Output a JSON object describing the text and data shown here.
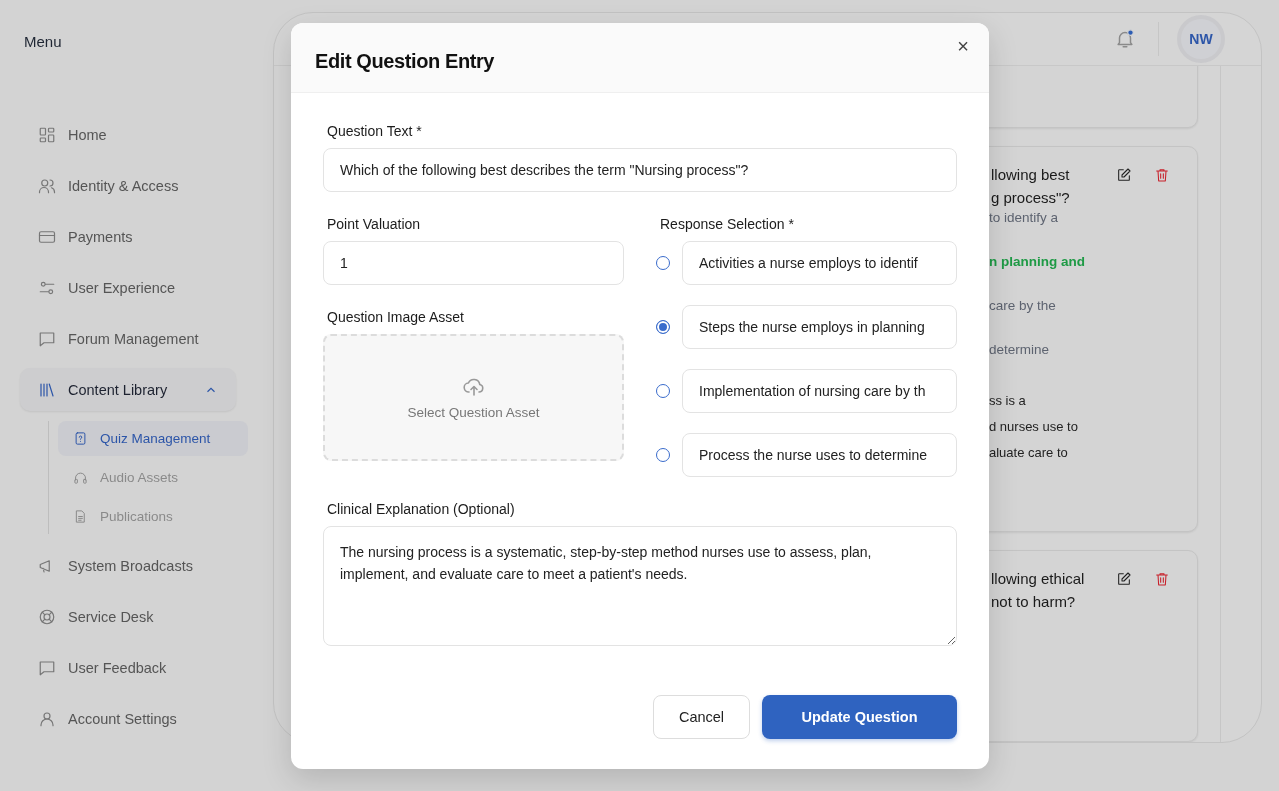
{
  "sidebar": {
    "title": "Menu",
    "items": [
      {
        "label": "Home",
        "selected": false
      },
      {
        "label": "Identity & Access",
        "selected": false
      },
      {
        "label": "Payments",
        "selected": false
      },
      {
        "label": "User Experience",
        "selected": false
      },
      {
        "label": "Forum Management",
        "selected": false
      },
      {
        "label": "Content Library",
        "selected": true,
        "expanded": true,
        "children": [
          {
            "label": "Quiz Management",
            "selected": true
          },
          {
            "label": "Audio Assets",
            "selected": false
          },
          {
            "label": "Publications",
            "selected": false
          }
        ]
      },
      {
        "label": "System Broadcasts",
        "selected": false
      },
      {
        "label": "Service Desk",
        "selected": false
      },
      {
        "label": "User Feedback",
        "selected": false
      },
      {
        "label": "Account Settings",
        "selected": false
      }
    ]
  },
  "header": {
    "notification_unread": true,
    "avatar": "NW"
  },
  "cards": [
    {
      "title_lines": [
        "llowing best",
        "g process\"?"
      ],
      "options": [
        {
          "text": "to identify a",
          "correct": false
        },
        {
          "text": "n planning and",
          "correct": true
        },
        {
          "text": "care by the",
          "correct": false
        },
        {
          "text": "determine",
          "correct": false
        }
      ],
      "explanation_lines": [
        "ss is a",
        "d nurses use to",
        "aluate care to"
      ]
    },
    {
      "title_lines": [
        "llowing ethical",
        "not to harm?"
      ]
    }
  ],
  "dialog": {
    "title": "Edit Question Entry",
    "close": "×",
    "question_label": "Question Text *",
    "question_value": "Which of the following best describes the term \"Nursing process\"?",
    "points_label": "Point Valuation",
    "points_value": "1",
    "image_label": "Question Image Asset",
    "image_prompt": "Select Question Asset",
    "responses_label": "Response Selection *",
    "responses": [
      {
        "text": "Activities a nurse employs to identif",
        "selected": false
      },
      {
        "text": "Steps the nurse employs in planning",
        "selected": true
      },
      {
        "text": "Implementation of nursing care by th",
        "selected": false
      },
      {
        "text": "Process the nurse uses to determine",
        "selected": false
      }
    ],
    "explanation_label": "Clinical Explanation (Optional)",
    "explanation_value": "The nursing process is a systematic, step-by-step method nurses use to assess, plan, implement, and evaluate care to meet a patient's needs.",
    "buttons": [
      {
        "label": "Cancel",
        "kind": "secondary"
      },
      {
        "label": "Update Question",
        "kind": "primary"
      }
    ]
  }
}
